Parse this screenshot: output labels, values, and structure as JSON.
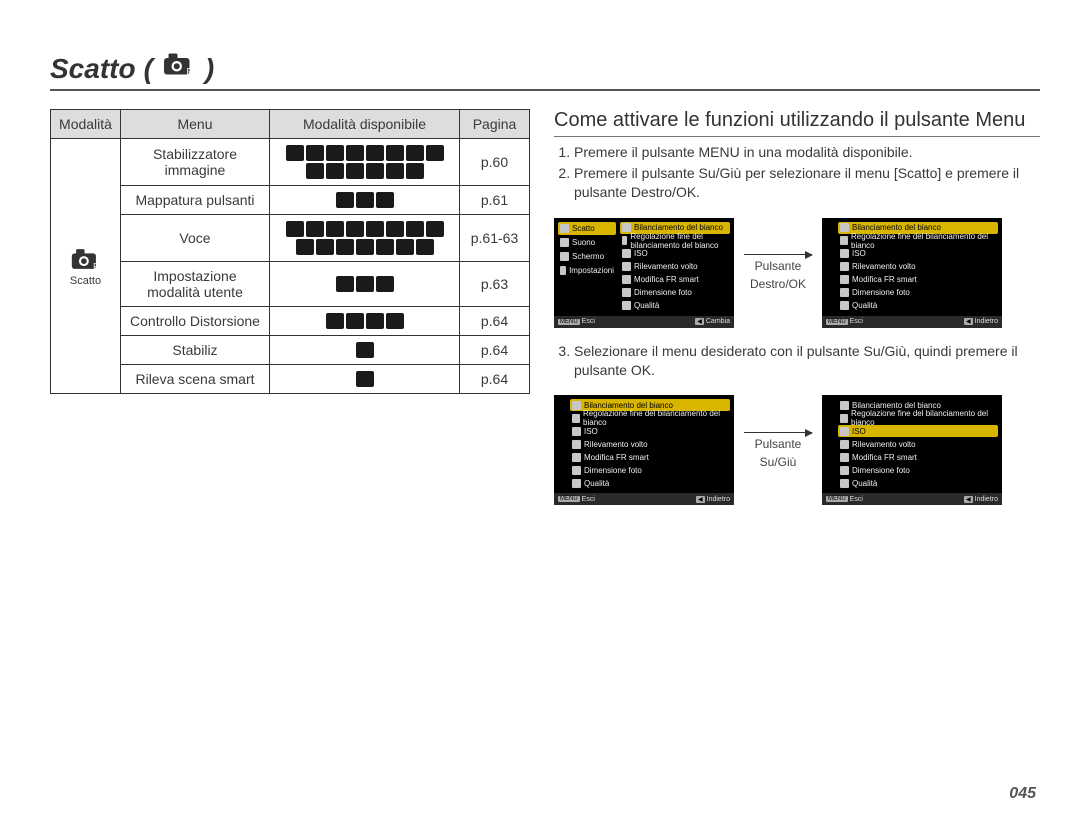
{
  "page_title": "Scatto",
  "page_number": "045",
  "table": {
    "headers": {
      "modalita": "Modalità",
      "menu": "Menu",
      "disponibile": "Modalità disponibile",
      "pagina": "Pagina"
    },
    "mode_label": "Scatto",
    "rows": [
      {
        "menu": "Stabilizzatore immagine",
        "icon_count": 14,
        "page": "p.60"
      },
      {
        "menu": "Mappatura pulsanti",
        "icon_count": 3,
        "page": "p.61"
      },
      {
        "menu": "Voce",
        "icon_count": 15,
        "page": "p.61-63"
      },
      {
        "menu": "Impostazione modalità utente",
        "icon_count": 3,
        "page": "p.63"
      },
      {
        "menu": "Controllo Distorsione",
        "icon_count": 4,
        "page": "p.64"
      },
      {
        "menu": "Stabiliz",
        "icon_count": 1,
        "page": "p.64"
      },
      {
        "menu": "Rileva scena smart",
        "icon_count": 1,
        "page": "p.64"
      }
    ]
  },
  "right": {
    "heading": "Come attivare le funzioni utilizzando il pulsante Menu",
    "steps": [
      "Premere il pulsante MENU in una modalità disponibile.",
      "Premere il pulsante Su/Giù per selezionare il menu [Scatto] e premere il pulsante Destro/OK.",
      "Selezionare il menu desiderato con il pulsante Su/Giù, quindi premere il pulsante OK."
    ],
    "arrow1_label_line1": "Pulsante",
    "arrow1_label_line2": "Destro/OK",
    "arrow2_label_line1": "Pulsante",
    "arrow2_label_line2": "Su/Giù"
  },
  "screen_side_items": [
    "Scatto",
    "Suono",
    "Schermo",
    "Impostazioni"
  ],
  "screen_menu_items": [
    "Bilanciamento del bianco",
    "Regolazione fine del bilanciamento del bianco",
    "ISO",
    "Rilevamento volto",
    "Modifica FR smart",
    "Dimensione foto",
    "Qualità"
  ],
  "screen_footer": {
    "menu_lbl": "MENU",
    "back_lbl": "◀",
    "esci": "Esci",
    "cambia": "Cambia",
    "indietro": "Indietro"
  }
}
